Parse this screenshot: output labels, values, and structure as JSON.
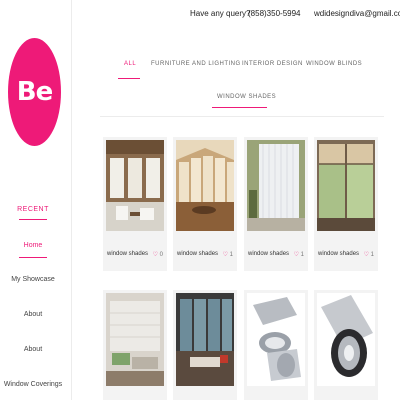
{
  "brand": {
    "logo_text": "Be",
    "accent": "#ee1a78"
  },
  "header": {
    "query_text": "Have any query?",
    "phone": "(858)350-5994",
    "email": "wdidesigndiva@gmail.com"
  },
  "sidebar": {
    "section_title": "RECENT",
    "items": [
      {
        "label": "Home"
      },
      {
        "label": "My Showcase"
      },
      {
        "label": "About"
      },
      {
        "label": "About"
      },
      {
        "label": "Window Coverings"
      }
    ]
  },
  "filters": [
    {
      "label": "ALL"
    },
    {
      "label": "FURNITURE AND LIGHTING"
    },
    {
      "label": "INTERIOR DESIGN"
    },
    {
      "label": "WINDOW BLINDS"
    },
    {
      "label": "WINDOW SHADES"
    }
  ],
  "gallery": {
    "row1": [
      {
        "caption": "window shades",
        "heart": "♡",
        "likes": "0"
      },
      {
        "caption": "window shades",
        "heart": "♡",
        "likes": "1"
      },
      {
        "caption": "window shades",
        "heart": "♡",
        "likes": "1"
      },
      {
        "caption": "window shades",
        "heart": "♡",
        "likes": "1"
      }
    ]
  }
}
